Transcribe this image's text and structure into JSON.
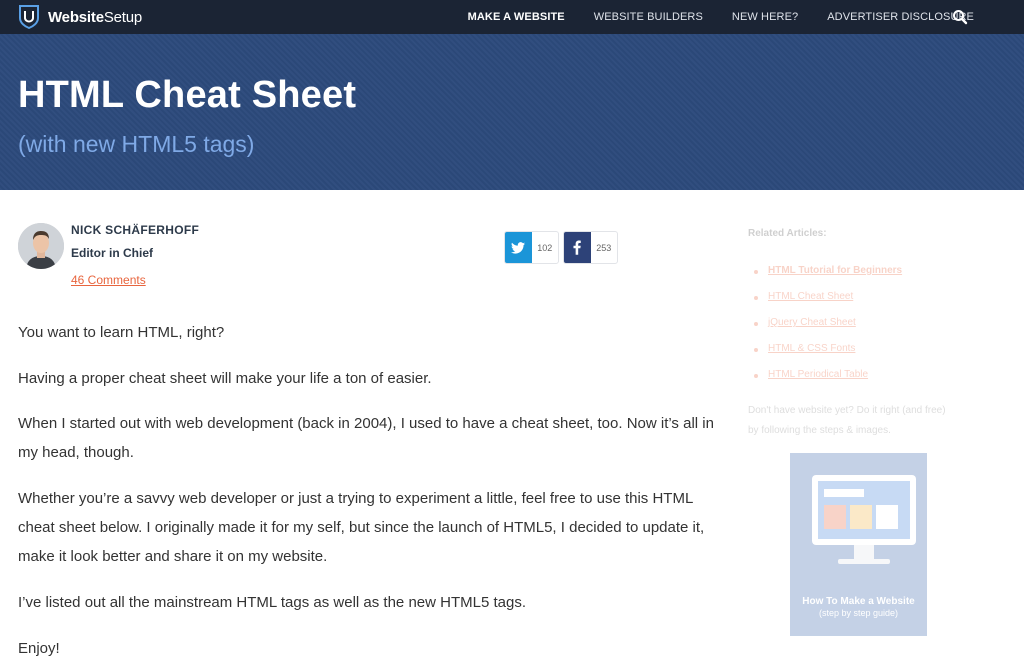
{
  "brand": {
    "name_bold": "Website",
    "name_rest": "Setup"
  },
  "nav": {
    "items": [
      "MAKE A WEBSITE",
      "WEBSITE BUILDERS",
      "NEW HERE?",
      "ADVERTISER DISCLOSURE"
    ],
    "search_icon": "search-icon"
  },
  "hero": {
    "title": "HTML Cheat Sheet",
    "subtitle": "(with new HTML5 tags)"
  },
  "author": {
    "name": "NICK SCHÄFERHOFF",
    "role": "Editor in Chief",
    "comments": "46 Comments"
  },
  "share": {
    "twitter_count": "102",
    "facebook_count": "253"
  },
  "article": {
    "paragraphs": [
      "You want to learn HTML, right?",
      "Having a proper cheat sheet will make your life a ton of easier.",
      "When I started out with web development (back in 2004), I used to have a cheat sheet, too. Now it’s all in my head, though.",
      "Whether you’re a savvy web developer or just a trying to experiment a little, feel free to use this HTML cheat sheet below. I originally made it for my self, but since the launch of HTML5, I decided to update it, make it look better and share it on my website.",
      "I’ve listed out all the mainstream HTML tags as well as the new HTML5 tags.",
      "Enjoy!"
    ]
  },
  "sidebar": {
    "heading": "Related Articles:",
    "links": [
      "HTML Tutorial for Beginners",
      "HTML Cheat Sheet",
      "jQuery Cheat Sheet",
      "HTML & CSS Fonts",
      "HTML Periodical Table"
    ],
    "note": "Don't have website yet? Do it right (and free) by following the steps & images.",
    "promo_title": "How To Make a Website",
    "promo_sub": "(step by step guide)"
  },
  "colors": {
    "nav_bg": "#1b2434",
    "hero_bg": "#2c4a7c",
    "accent": "#e8653e",
    "twitter": "#1b95d8",
    "facebook": "#2d4278"
  }
}
